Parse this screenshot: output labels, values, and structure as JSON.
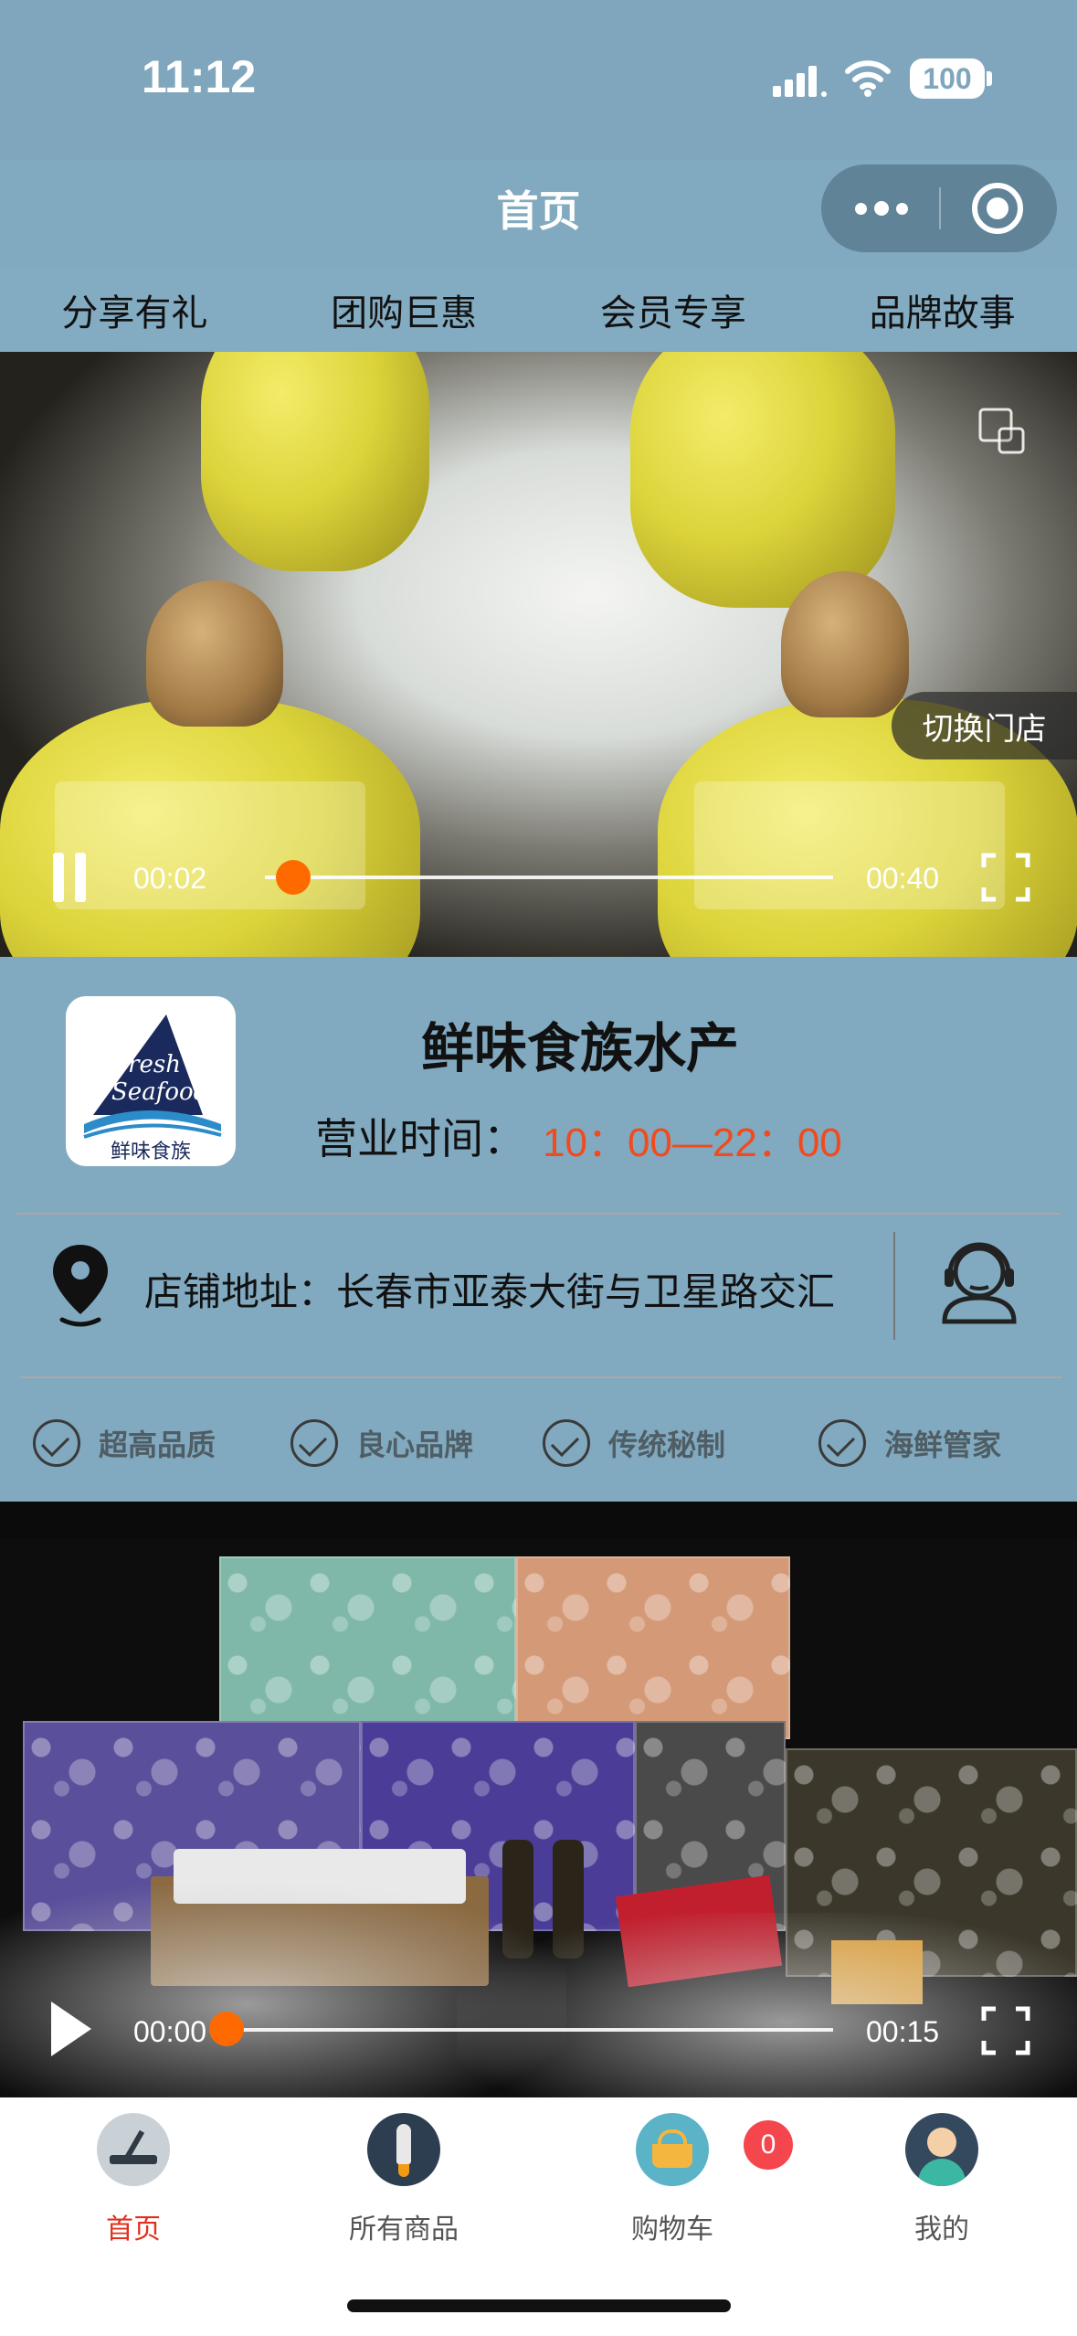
{
  "status_bar": {
    "time": "11:12",
    "battery": "100"
  },
  "nav": {
    "title": "首页"
  },
  "category_tabs": [
    {
      "label": "分享有礼"
    },
    {
      "label": "团购巨惠"
    },
    {
      "label": "会员专享"
    },
    {
      "label": "品牌故事"
    }
  ],
  "video1": {
    "switch_store_label": "切换门店",
    "current_time": "00:02",
    "duration": "00:40",
    "progress": 0.05,
    "state": "playing"
  },
  "store": {
    "logo_text_en": "Fresh Seafood",
    "logo_text_cn": "鲜味食族",
    "name": "鲜味食族水产",
    "hours_label": "营业时间：",
    "hours_value": "10：00—22：00",
    "address": "店铺地址：长春市亚泰大街与卫星路交汇",
    "features": [
      "超高品质",
      "良心品牌",
      "传统秘制",
      "海鲜管家"
    ]
  },
  "video2": {
    "current_time": "00:00",
    "duration": "00:15",
    "progress": 0.0,
    "state": "paused"
  },
  "tabbar": {
    "items": [
      {
        "label": "首页",
        "icon": "home-icon",
        "active": true
      },
      {
        "label": "所有商品",
        "icon": "rocket-icon",
        "active": false
      },
      {
        "label": "购物车",
        "icon": "cart-icon",
        "active": false
      },
      {
        "label": "我的",
        "icon": "profile-icon",
        "active": false
      }
    ],
    "cart_badge": "0"
  },
  "colors": {
    "primary_bg": "#81a9bf",
    "accent_orange": "#ff6a00",
    "hours_red": "#f24a1c",
    "tab_active": "#e0301e",
    "badge": "#f5454d"
  }
}
